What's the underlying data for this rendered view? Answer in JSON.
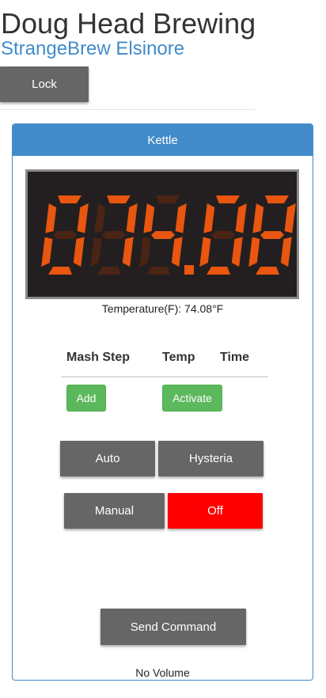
{
  "header": {
    "title": "Doug Head Brewing",
    "subtitle": "StrangeBrew Elsinore",
    "lock_label": "Lock"
  },
  "kettle": {
    "title": "Kettle",
    "display_digits": "074.08",
    "temperature_label": "Temperature(F): 74.08°F",
    "mash_table": {
      "headers": [
        "Mash Step",
        "Temp",
        "Time"
      ],
      "add_label": "Add",
      "activate_label": "Activate"
    },
    "modes": {
      "auto": "Auto",
      "hysteria": "Hysteria",
      "manual": "Manual",
      "off": "Off"
    },
    "send_command_label": "Send Command",
    "volume_status": "No Volume"
  },
  "colors": {
    "primary": "#428bca",
    "success": "#5cb85c",
    "off_active": "#ff0000",
    "segment_on": "#e8560f",
    "segment_off": "#4a2414",
    "display_bg": "#231f20"
  }
}
